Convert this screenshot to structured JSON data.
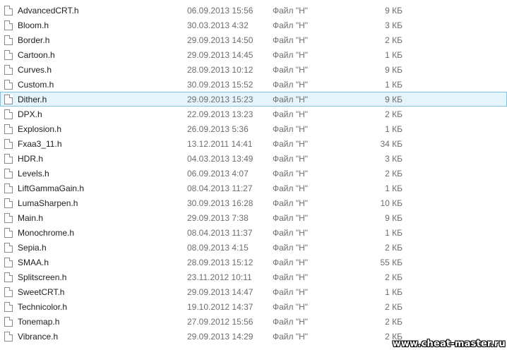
{
  "files": [
    {
      "name": "AdvancedCRT.h",
      "date": "06.09.2013 15:56",
      "type": "Файл \"H\"",
      "size": "9 КБ"
    },
    {
      "name": "Bloom.h",
      "date": "30.03.2013 4:32",
      "type": "Файл \"H\"",
      "size": "3 КБ"
    },
    {
      "name": "Border.h",
      "date": "29.09.2013 14:50",
      "type": "Файл \"H\"",
      "size": "2 КБ"
    },
    {
      "name": "Cartoon.h",
      "date": "29.09.2013 14:45",
      "type": "Файл \"H\"",
      "size": "1 КБ"
    },
    {
      "name": "Curves.h",
      "date": "28.09.2013 10:12",
      "type": "Файл \"H\"",
      "size": "9 КБ"
    },
    {
      "name": "Custom.h",
      "date": "30.09.2013 15:52",
      "type": "Файл \"H\"",
      "size": "1 КБ"
    },
    {
      "name": "Dither.h",
      "date": "29.09.2013 15:23",
      "type": "Файл \"H\"",
      "size": "9 КБ",
      "selected": true
    },
    {
      "name": "DPX.h",
      "date": "22.09.2013 13:23",
      "type": "Файл \"H\"",
      "size": "2 КБ"
    },
    {
      "name": "Explosion.h",
      "date": "26.09.2013 5:36",
      "type": "Файл \"H\"",
      "size": "1 КБ"
    },
    {
      "name": "Fxaa3_11.h",
      "date": "13.12.2011 14:41",
      "type": "Файл \"H\"",
      "size": "34 КБ"
    },
    {
      "name": "HDR.h",
      "date": "04.03.2013 13:49",
      "type": "Файл \"H\"",
      "size": "3 КБ"
    },
    {
      "name": "Levels.h",
      "date": "06.09.2013 4:07",
      "type": "Файл \"H\"",
      "size": "2 КБ"
    },
    {
      "name": "LiftGammaGain.h",
      "date": "08.04.2013 11:27",
      "type": "Файл \"H\"",
      "size": "1 КБ"
    },
    {
      "name": "LumaSharpen.h",
      "date": "30.09.2013 16:28",
      "type": "Файл \"H\"",
      "size": "10 КБ"
    },
    {
      "name": "Main.h",
      "date": "29.09.2013 7:38",
      "type": "Файл \"H\"",
      "size": "9 КБ"
    },
    {
      "name": "Monochrome.h",
      "date": "08.04.2013 11:37",
      "type": "Файл \"H\"",
      "size": "1 КБ"
    },
    {
      "name": "Sepia.h",
      "date": "08.09.2013 4:15",
      "type": "Файл \"H\"",
      "size": "2 КБ"
    },
    {
      "name": "SMAA.h",
      "date": "28.09.2013 15:12",
      "type": "Файл \"H\"",
      "size": "55 КБ"
    },
    {
      "name": "Splitscreen.h",
      "date": "23.11.2012 10:11",
      "type": "Файл \"H\"",
      "size": "2 КБ"
    },
    {
      "name": "SweetCRT.h",
      "date": "29.09.2013 14:47",
      "type": "Файл \"H\"",
      "size": "1 КБ"
    },
    {
      "name": "Technicolor.h",
      "date": "19.10.2012 14:37",
      "type": "Файл \"H\"",
      "size": "2 КБ"
    },
    {
      "name": "Tonemap.h",
      "date": "27.09.2012 15:56",
      "type": "Файл \"H\"",
      "size": "2 КБ"
    },
    {
      "name": "Vibrance.h",
      "date": "29.09.2013 14:29",
      "type": "Файл \"H\"",
      "size": "2 КБ"
    }
  ],
  "icon": "document-file-icon",
  "watermark": "www.cheat-master.ru",
  "colors": {
    "selection_bg": "#e5f3fb",
    "selection_border": "#7fc3e8"
  }
}
